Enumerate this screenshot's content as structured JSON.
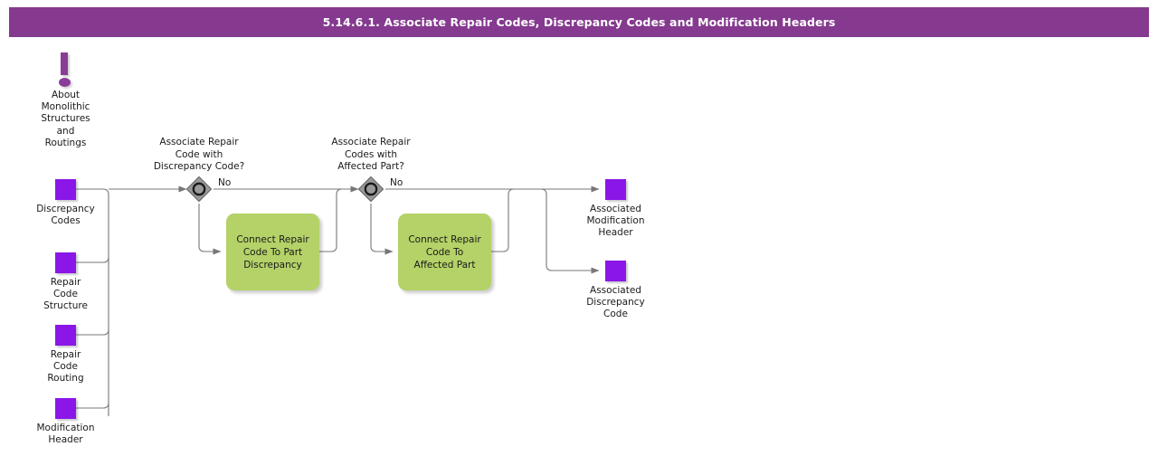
{
  "header": {
    "title": "5.14.6.1. Associate Repair Codes, Discrepancy Codes and Modification Headers",
    "background_color": "#85398F",
    "text_color": "#FFFFFF"
  },
  "palette": {
    "data_object_purple": "#8A16E8",
    "note_purple": "#8A3C99",
    "task_green": "#B4D268",
    "gateway_gray": "#999999",
    "connector_gray": "#777777"
  },
  "notes": [
    {
      "id": "about-monolithic",
      "icon": "exclamation-icon",
      "label": "About\nMonolithic\nStructures\nand\nRoutings"
    }
  ],
  "inputs": [
    {
      "id": "discrepancy-codes",
      "label": "Discrepancy\nCodes"
    },
    {
      "id": "repair-code-structure",
      "label": "Repair\nCode\nStructure"
    },
    {
      "id": "repair-code-routing",
      "label": "Repair\nCode\nRouting"
    },
    {
      "id": "modification-header",
      "label": "Modification\nHeader"
    }
  ],
  "gateways": [
    {
      "id": "gw-discrepancy-code",
      "type": "inclusive-gateway",
      "label": "Associate Repair\nCode with\nDiscrepancy Code?",
      "outgoing_label": "No"
    },
    {
      "id": "gw-affected-part",
      "type": "inclusive-gateway",
      "label": "Associate Repair\nCodes with\nAffected Part?",
      "outgoing_label": "No"
    }
  ],
  "tasks": [
    {
      "id": "connect-repair-code-part-discrepancy",
      "label": "Connect Repair\nCode To Part\nDiscrepancy"
    },
    {
      "id": "connect-repair-code-affected-part",
      "label": "Connect Repair\nCode To\nAffected Part"
    }
  ],
  "outputs": [
    {
      "id": "associated-modification-header",
      "label": "Associated\nModification\nHeader"
    },
    {
      "id": "associated-discrepancy-code",
      "label": "Associated\nDiscrepancy\nCode"
    }
  ]
}
